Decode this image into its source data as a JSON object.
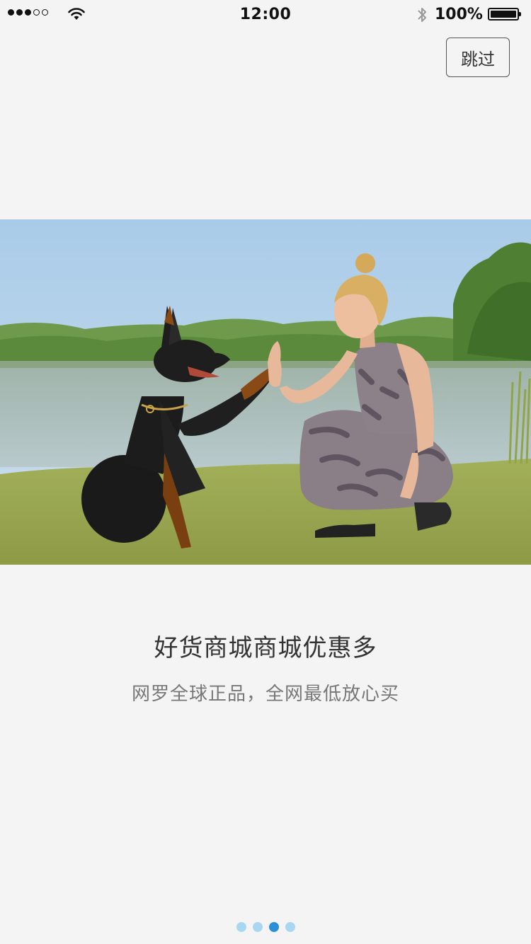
{
  "status_bar": {
    "time": "12:00",
    "battery": "100%",
    "signal_bars_filled": 3,
    "signal_bars_total": 5,
    "icons": [
      "signal-icon",
      "wifi-icon",
      "bluetooth-icon",
      "battery-icon"
    ]
  },
  "header": {
    "skip_label": "跳过"
  },
  "slide": {
    "image": "woman-giving-high-five-to-doberman-by-lake",
    "title": "好货商城商城优惠多",
    "subtitle": "网罗全球正品，全网最低放心买"
  },
  "pager": {
    "count": 4,
    "active_index": 2,
    "active_color": "#2a8fd7",
    "inactive_color": "#a9d7f2"
  }
}
